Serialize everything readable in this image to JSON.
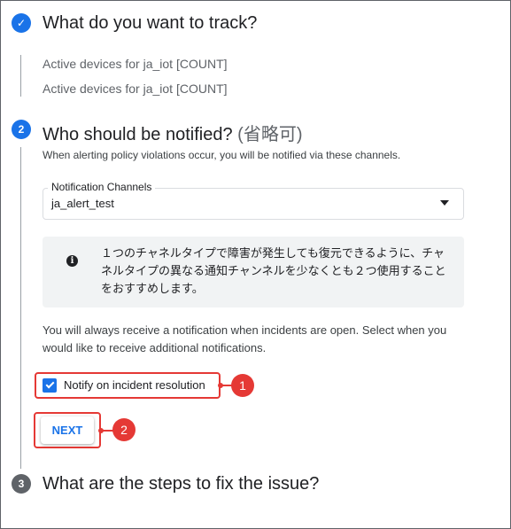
{
  "steps": {
    "step1": {
      "number": "✓",
      "title": "What do you want to track?",
      "tracked_items": [
        "Active devices for ja_iot [COUNT]",
        "Active devices for ja_iot [COUNT]"
      ]
    },
    "step2": {
      "number": "2",
      "title": "Who should be notified?",
      "optional": "(省略可)",
      "subtitle": "When alerting policy violations occur, you will be notified via these channels.",
      "channels_label": "Notification Channels",
      "channels_value": "ja_alert_test",
      "info_icon": "i",
      "info_text": "１つのチャネルタイプで障害が発生しても復元できるように、チャネルタイプの異なる通知チャンネルを少なくとも２つ使用することをおすすめします。",
      "always_text": "You will always receive a notification when incidents are open. Select when you would like to receive additional notifications.",
      "checkbox_label": "Notify on incident resolution",
      "checkbox_checked": true,
      "next_label": "NEXT"
    },
    "step3": {
      "number": "3",
      "title": "What are the steps to fix the issue?"
    }
  },
  "callouts": [
    "1",
    "2"
  ],
  "colors": {
    "accent": "#1a73e8",
    "callout": "#e53935",
    "pending": "#5f6368"
  }
}
